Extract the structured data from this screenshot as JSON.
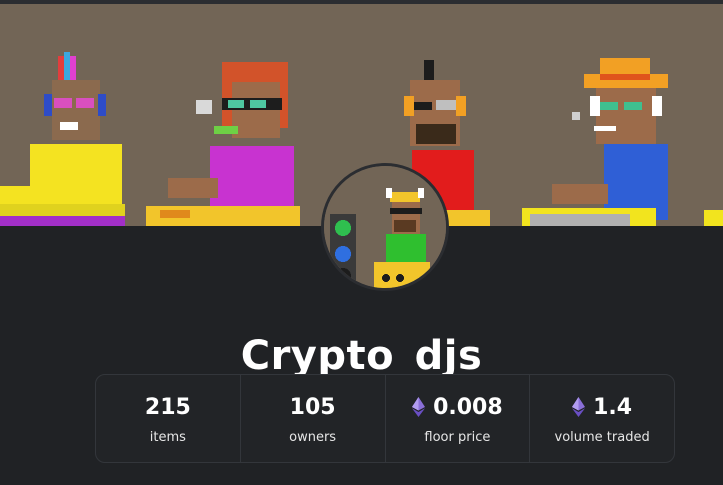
{
  "collection": {
    "name": "Crypto_djs"
  },
  "stats": [
    {
      "value": "215",
      "label": "items",
      "icon": ""
    },
    {
      "value": "105",
      "label": "owners",
      "icon": ""
    },
    {
      "value": "0.008",
      "label": "floor price",
      "icon": "ethereum-icon"
    },
    {
      "value": "1.4",
      "label": "volume traded",
      "icon": "ethereum-icon"
    }
  ],
  "colors": {
    "background": "#202225",
    "banner": "#726556",
    "eth_purple": "#8a6fd8"
  }
}
